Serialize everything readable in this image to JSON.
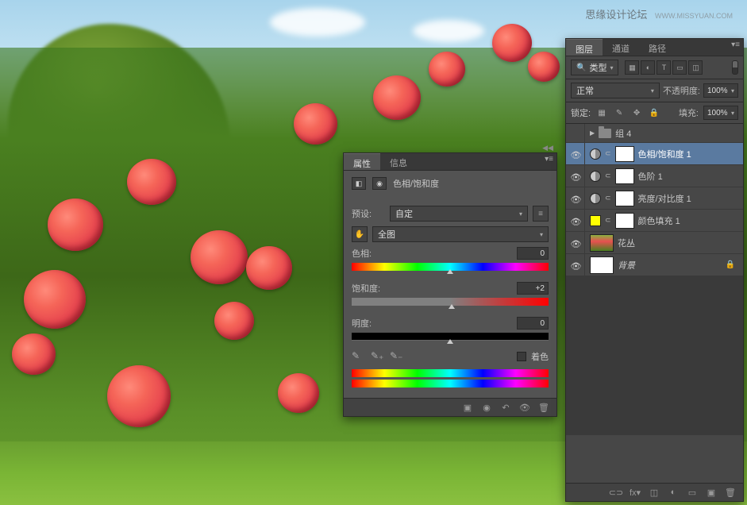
{
  "watermark": {
    "text": "思缘设计论坛",
    "url": "WWW.MISSYUAN.COM"
  },
  "properties_panel": {
    "tabs": [
      "属性",
      "信息"
    ],
    "adjustment_name": "色相/饱和度",
    "preset_label": "预设:",
    "preset_value": "自定",
    "range_value": "全图",
    "hue_label": "色相:",
    "hue_value": "0",
    "saturation_label": "饱和度:",
    "saturation_value": "+2",
    "lightness_label": "明度:",
    "lightness_value": "0",
    "colorize_label": "着色"
  },
  "layers_panel": {
    "tabs": [
      "图层",
      "通道",
      "路径"
    ],
    "filter_label": "类型",
    "blend_mode": "正常",
    "opacity_label": "不透明度:",
    "opacity_value": "100%",
    "lock_label": "锁定:",
    "fill_label": "填充:",
    "fill_value": "100%",
    "layers": [
      {
        "kind": "group",
        "name": "组 4"
      },
      {
        "kind": "adj",
        "name": "色相/饱和度 1",
        "selected": true
      },
      {
        "kind": "adj",
        "name": "色阶 1"
      },
      {
        "kind": "adj",
        "name": "亮度/对比度 1"
      },
      {
        "kind": "fill",
        "name": "颜色填充 1"
      },
      {
        "kind": "image",
        "name": "花丛"
      },
      {
        "kind": "bg",
        "name": "背景",
        "locked": true
      }
    ]
  }
}
